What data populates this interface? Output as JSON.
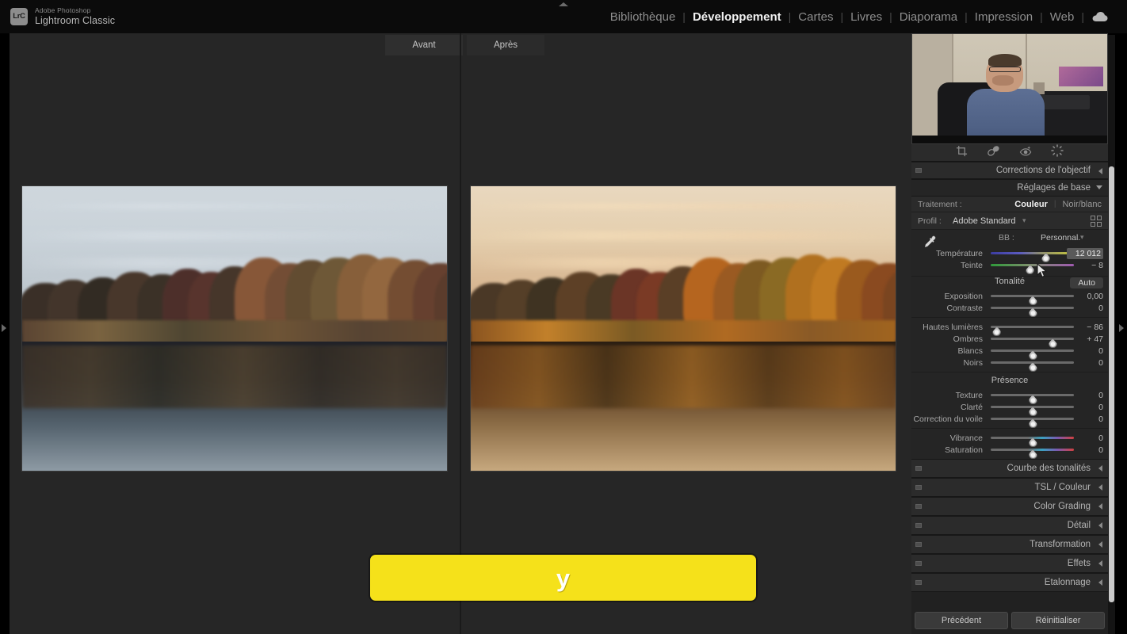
{
  "app": {
    "brand_badge": "LrC",
    "brand_sup": "Adobe Photoshop",
    "brand_main": "Lightroom Classic"
  },
  "modules": {
    "items": [
      {
        "label": "Bibliothèque",
        "active": false
      },
      {
        "label": "Développement",
        "active": true
      },
      {
        "label": "Cartes",
        "active": false
      },
      {
        "label": "Livres",
        "active": false
      },
      {
        "label": "Diaporama",
        "active": false
      },
      {
        "label": "Impression",
        "active": false
      },
      {
        "label": "Web",
        "active": false
      }
    ],
    "separator": "|",
    "cloud_icon": "cloud-icon"
  },
  "workarea": {
    "before_tab": "Avant",
    "after_tab": "Après",
    "before_photo_alt": "Photo avant : lac d'automne avec arbres reflétés, tons froids",
    "after_photo_alt": "Photo après : lac d'automne avec arbres reflétés, tons dorés chauds"
  },
  "caption": {
    "text": "y",
    "background": "#f5e11a",
    "text_color": "#ffffff"
  },
  "tools": {
    "items": [
      {
        "name": "crop-tool-icon",
        "title": "Recadrage"
      },
      {
        "name": "spot-removal-tool-icon",
        "title": "Retouche des tons directs"
      },
      {
        "name": "red-eye-tool-icon",
        "title": "Correction des yeux rouges"
      },
      {
        "name": "masking-tool-icon",
        "title": "Masquage"
      }
    ]
  },
  "panels": {
    "lens_corrections": {
      "title": "Corrections de l'objectif",
      "collapsed": true
    },
    "basic": {
      "title": "Réglages de base",
      "collapsed": false,
      "treatment_label": "Traitement :",
      "treatment_options": [
        {
          "label": "Couleur",
          "selected": true
        },
        {
          "label": "Noir/blanc",
          "selected": false
        }
      ],
      "profile_label": "Profil :",
      "profile_value": "Adobe Standard",
      "white_balance": {
        "label": "BB :",
        "value": "Personnal.",
        "eyedropper": "eyedropper-icon",
        "sliders": [
          {
            "name": "Température",
            "value": "12 012",
            "pos": 66,
            "grad": "grad-temp",
            "highlight": true
          },
          {
            "name": "Teinte",
            "value": "− 8",
            "pos": 47,
            "grad": "grad-tint",
            "highlight": false
          }
        ]
      },
      "tone": {
        "title": "Tonalité",
        "auto_label": "Auto",
        "sliders": [
          {
            "name": "Exposition",
            "value": "0,00",
            "pos": 50,
            "grad": "",
            "highlight": false
          },
          {
            "name": "Contraste",
            "value": "0",
            "pos": 50,
            "grad": "",
            "highlight": false
          },
          {
            "name": "Hautes lumières",
            "value": "− 86",
            "pos": 7,
            "grad": "",
            "highlight": false
          },
          {
            "name": "Ombres",
            "value": "+ 47",
            "pos": 74,
            "grad": "",
            "highlight": false
          },
          {
            "name": "Blancs",
            "value": "0",
            "pos": 50,
            "grad": "",
            "highlight": false
          },
          {
            "name": "Noirs",
            "value": "0",
            "pos": 50,
            "grad": "",
            "highlight": false
          }
        ]
      },
      "presence": {
        "title": "Présence",
        "sliders": [
          {
            "name": "Texture",
            "value": "0",
            "pos": 50,
            "grad": "",
            "highlight": false
          },
          {
            "name": "Clarté",
            "value": "0",
            "pos": 50,
            "grad": "",
            "highlight": false
          },
          {
            "name": "Correction du voile",
            "value": "0",
            "pos": 50,
            "grad": "",
            "highlight": false
          },
          {
            "name": "Vibrance",
            "value": "0",
            "pos": 50,
            "grad": "grad-vib",
            "highlight": false
          },
          {
            "name": "Saturation",
            "value": "0",
            "pos": 50,
            "grad": "grad-vib",
            "highlight": false
          }
        ]
      }
    },
    "collapsed_list": [
      {
        "title": "Courbe des tonalités"
      },
      {
        "title": "TSL / Couleur"
      },
      {
        "title": "Color Grading"
      },
      {
        "title": "Détail"
      },
      {
        "title": "Transformation"
      },
      {
        "title": "Effets"
      },
      {
        "title": "Etalonnage"
      }
    ]
  },
  "footer": {
    "previous_label": "Précédent",
    "reset_label": "Réinitialiser"
  }
}
